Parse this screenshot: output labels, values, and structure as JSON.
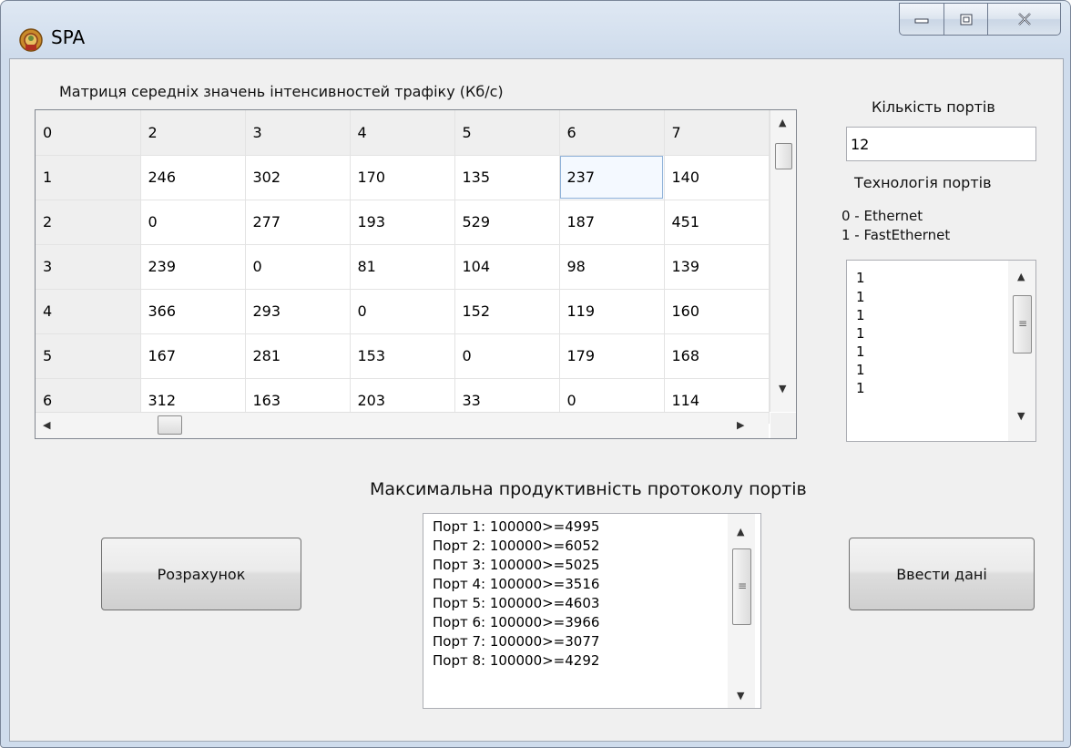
{
  "window": {
    "title": "SPA",
    "icon": "app-icon"
  },
  "matrix": {
    "label": "Матриця середніх значень інтенсивностей трафіку (Кб/с)",
    "header": [
      "0",
      "2",
      "3",
      "4",
      "5",
      "6",
      "7"
    ],
    "rows": [
      [
        "1",
        "246",
        "302",
        "170",
        "135",
        "237",
        "140"
      ],
      [
        "2",
        "0",
        "277",
        "193",
        "529",
        "187",
        "451"
      ],
      [
        "3",
        "239",
        "0",
        "81",
        "104",
        "98",
        "139"
      ],
      [
        "4",
        "366",
        "293",
        "0",
        "152",
        "119",
        "160"
      ],
      [
        "5",
        "167",
        "281",
        "153",
        "0",
        "179",
        "168"
      ],
      [
        "6",
        "312",
        "163",
        "203",
        "33",
        "0",
        "114"
      ]
    ]
  },
  "ports": {
    "count_label": "Кількість портів",
    "count_value": "12",
    "tech_label": "Технологія портів",
    "legend": [
      "0 - Ethernet",
      "1 - FastEthernet"
    ],
    "tech_values": [
      "1",
      "1",
      "1",
      "1",
      "1",
      "1",
      "1"
    ]
  },
  "results": {
    "label": "Максимальна продуктивність протоколу портів",
    "items": [
      "Порт 1: 100000>=4995",
      "Порт 2: 100000>=6052",
      "Порт 3: 100000>=5025",
      "Порт 4: 100000>=3516",
      "Порт 5: 100000>=4603",
      "Порт 6: 100000>=3966",
      "Порт 7: 100000>=3077",
      "Порт 8: 100000>=4292"
    ]
  },
  "buttons": {
    "calculate": "Розрахунок",
    "enter_data": "Ввести дані"
  }
}
